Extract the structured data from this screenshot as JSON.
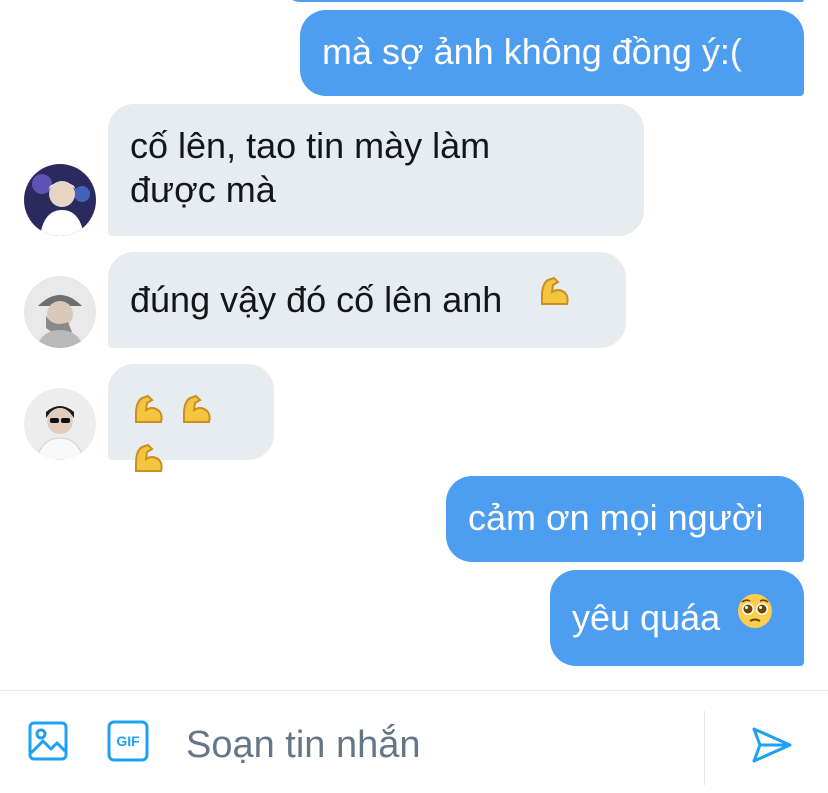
{
  "messages": [
    {
      "direction": "out",
      "text": "mà sợ ảnh không đồng ý:("
    },
    {
      "direction": "in",
      "line1": "cố lên, tao tin mày làm",
      "line2": "được mà",
      "avatar": "avatar-person-stage-lights"
    },
    {
      "direction": "in",
      "text": "đúng vậy đó cố lên anh",
      "emoji": "flexed-biceps-icon",
      "avatar": "avatar-person-hat-selfie"
    },
    {
      "direction": "in",
      "emojis": [
        "flexed-biceps-icon",
        "flexed-biceps-icon",
        "flexed-biceps-icon"
      ],
      "avatar": "avatar-person-sunglasses"
    },
    {
      "direction": "out",
      "text": "cảm ơn mọi người"
    },
    {
      "direction": "out",
      "text": "yêu quáa",
      "emoji": "pleading-face-icon"
    }
  ],
  "composer": {
    "placeholder": "Soạn tin nhắn",
    "gif_label": "GIF",
    "icons": [
      "image-icon",
      "gif-icon",
      "send-icon"
    ]
  },
  "colors": {
    "outgoing_bubble": "#4d9ef0",
    "incoming_bubble": "#e6ecf0",
    "accent": "#1da1f2",
    "placeholder": "#657786"
  }
}
